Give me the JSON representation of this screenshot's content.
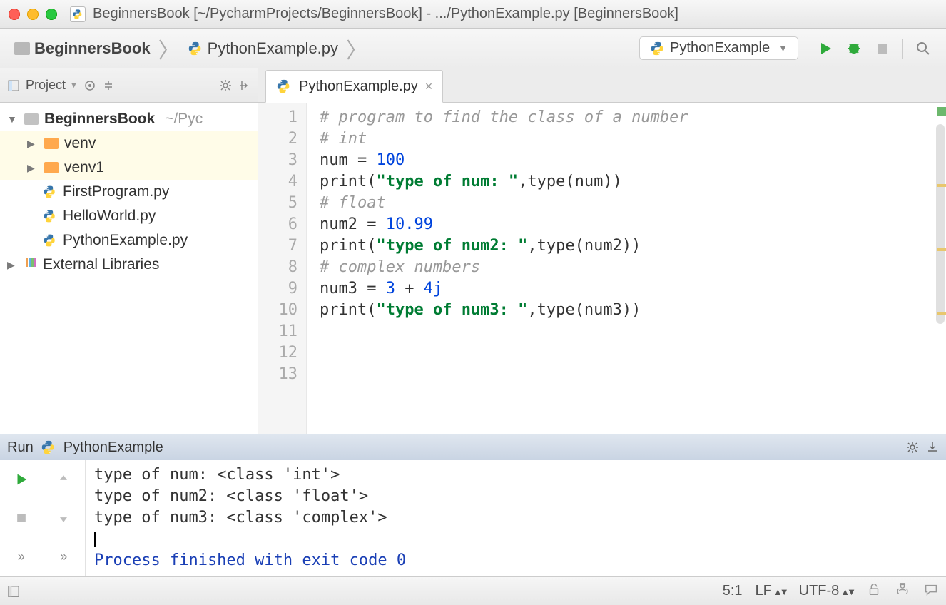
{
  "titlebar": {
    "text": "BeginnersBook [~/PycharmProjects/BeginnersBook] - .../PythonExample.py [BeginnersBook]"
  },
  "breadcrumb": {
    "items": [
      {
        "label": "BeginnersBook",
        "type": "folder"
      },
      {
        "label": "PythonExample.py",
        "type": "pyfile"
      }
    ]
  },
  "runconfig": {
    "label": "PythonExample"
  },
  "project_toolbar": {
    "label": "Project"
  },
  "tree": {
    "root": {
      "label": "BeginnersBook",
      "path": "~/Pyc"
    },
    "children": [
      {
        "label": "venv",
        "type": "folder"
      },
      {
        "label": "venv1",
        "type": "folder"
      },
      {
        "label": "FirstProgram.py",
        "type": "pyfile"
      },
      {
        "label": "HelloWorld.py",
        "type": "pyfile"
      },
      {
        "label": "PythonExample.py",
        "type": "pyfile"
      }
    ],
    "external": {
      "label": "External Libraries"
    }
  },
  "editor": {
    "tab": {
      "label": "PythonExample.py"
    },
    "code_lines": [
      "# program to find the class of a number",
      "",
      "# int",
      "num = 100",
      "print(\"type of num: \",type(num))",
      "",
      "# float",
      "num2 = 10.99",
      "print(\"type of num2: \",type(num2))",
      "",
      "# complex numbers",
      "num3 = 3 + 4j",
      "print(\"type of num3: \",type(num3))"
    ]
  },
  "run": {
    "title_prefix": "Run",
    "config": "PythonExample",
    "output": [
      "type of num:  <class 'int'>",
      "type of num2:  <class 'float'>",
      "type of num3:  <class 'complex'>",
      "",
      "Process finished with exit code 0"
    ]
  },
  "status": {
    "pos": "5:1",
    "line_sep": "LF",
    "encoding": "UTF-8"
  }
}
